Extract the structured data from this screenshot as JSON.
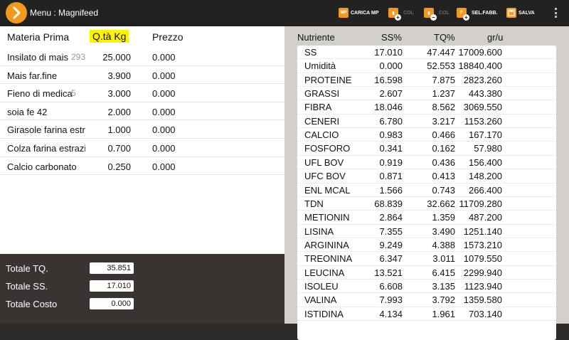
{
  "toolbar": {
    "title": "Menu : Magnifeed",
    "carica_mp": "CARICA MP",
    "carica_icon_text": "MP",
    "add_col": "COL",
    "remove_col": "COL",
    "sel_fabb": "SEL.FABB.",
    "salva": "SALVA",
    "accent_color": "#f39a1e"
  },
  "left": {
    "headers": {
      "materia_prima": "Materia Prima",
      "qta": "Q.tà Kg",
      "prezzo": "Prezzo"
    },
    "rows": [
      {
        "name": "Insilato di mais",
        "extra": "293",
        "qta": "25.000",
        "prezzo": "0.000"
      },
      {
        "name": "Mais far.fine",
        "extra": "",
        "qta": "3.900",
        "prezzo": "0.000"
      },
      {
        "name": "Fieno di medica",
        "extra": "5",
        "qta": "3.000",
        "prezzo": "0.000"
      },
      {
        "name": "soia fe 42",
        "extra": "",
        "qta": "2.000",
        "prezzo": "0.000"
      },
      {
        "name": "Girasole farina estr",
        "extra": "",
        "qta": "1.000",
        "prezzo": "0.000"
      },
      {
        "name": "Colza farina estrazi",
        "extra": "",
        "qta": "0.700",
        "prezzo": "0.000"
      },
      {
        "name": "Calcio carbonato",
        "extra": "",
        "qta": "0.250",
        "prezzo": "0.000"
      }
    ]
  },
  "totals": {
    "tq_label": "Totale TQ.",
    "tq_value": "35.851",
    "ss_label": "Totale SS.",
    "ss_value": "17.010",
    "costo_label": "Totale Costo",
    "costo_value": "0.000"
  },
  "right": {
    "headers": {
      "nutriente": "Nutriente",
      "ss": "SS%",
      "tq": "TQ%",
      "gru": "gr/u"
    },
    "rows": [
      {
        "name": "SS",
        "ss": "17.010",
        "tq": "47.447",
        "gru": "17009.600"
      },
      {
        "name": "Umidità",
        "ss": "0.000",
        "tq": "52.553",
        "gru": "18840.400"
      },
      {
        "name": "PROTEINE",
        "ss": "16.598",
        "tq": "7.875",
        "gru": "2823.260"
      },
      {
        "name": "GRASSI",
        "ss": "2.607",
        "tq": "1.237",
        "gru": "443.380"
      },
      {
        "name": "FIBRA",
        "ss": "18.046",
        "tq": "8.562",
        "gru": "3069.550"
      },
      {
        "name": "CENERI",
        "ss": "6.780",
        "tq": "3.217",
        "gru": "1153.260"
      },
      {
        "name": "CALCIO",
        "ss": "0.983",
        "tq": "0.466",
        "gru": "167.170"
      },
      {
        "name": "FOSFORO",
        "ss": "0.341",
        "tq": "0.162",
        "gru": "57.980"
      },
      {
        "name": "UFL BOV",
        "ss": "0.919",
        "tq": "0.436",
        "gru": "156.400"
      },
      {
        "name": "UFC BOV",
        "ss": "0.871",
        "tq": "0.413",
        "gru": "148.200"
      },
      {
        "name": "ENL MCAL",
        "ss": "1.566",
        "tq": "0.743",
        "gru": "266.400"
      },
      {
        "name": "TDN",
        "ss": "68.839",
        "tq": "32.662",
        "gru": "11709.280"
      },
      {
        "name": "METIONIN",
        "ss": "2.864",
        "tq": "1.359",
        "gru": "487.200"
      },
      {
        "name": "LISINA",
        "ss": "7.355",
        "tq": "3.490",
        "gru": "1251.140"
      },
      {
        "name": "ARGININA",
        "ss": "9.249",
        "tq": "4.388",
        "gru": "1573.210"
      },
      {
        "name": "TREONINA",
        "ss": "6.347",
        "tq": "3.011",
        "gru": "1079.550"
      },
      {
        "name": "LEUCINA",
        "ss": "13.521",
        "tq": "6.415",
        "gru": "2299.940"
      },
      {
        "name": "ISOLEU",
        "ss": "6.608",
        "tq": "3.135",
        "gru": "1123.940"
      },
      {
        "name": "VALINA",
        "ss": "7.993",
        "tq": "3.792",
        "gru": "1359.580"
      },
      {
        "name": "ISTIDINA",
        "ss": "4.134",
        "tq": "1.961",
        "gru": "703.140"
      }
    ]
  }
}
